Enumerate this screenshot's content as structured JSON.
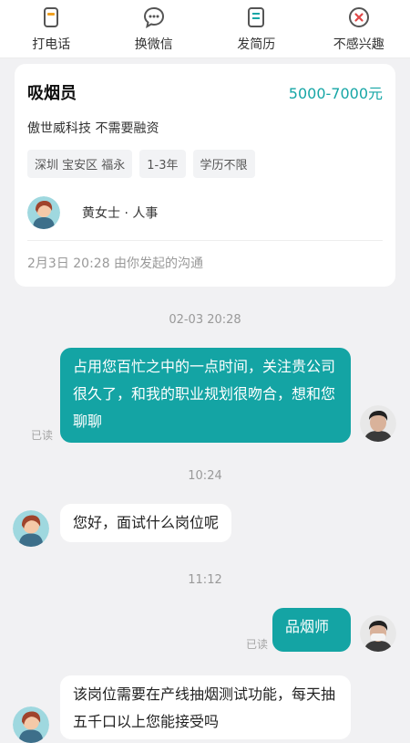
{
  "top_actions": [
    {
      "label": "打电话",
      "icon": "phone-icon"
    },
    {
      "label": "换微信",
      "icon": "wechat-icon"
    },
    {
      "label": "发简历",
      "icon": "resume-icon"
    },
    {
      "label": "不感兴趣",
      "icon": "not-interested-icon"
    }
  ],
  "job": {
    "title": "吸烟员",
    "salary": "5000-7000元",
    "company": "傲世威科技  不需要融资",
    "tags": [
      "深圳 宝安区 福永",
      "1-3年",
      "学历不限"
    ],
    "recruiter": "黄女士 · 人事",
    "chat_origin": "2月3日 20:28 由你发起的沟通"
  },
  "messages": {
    "time_1": "02-03 20:28",
    "msg_1": "占用您百忙之中的一点时间，关注贵公司很久了，和我的职业规划很吻合，想和您聊聊",
    "read_1": "已读",
    "time_2": "10:24",
    "msg_2": "您好，面试什么岗位呢",
    "time_3": "11:12",
    "msg_3": "品烟师",
    "read_3": "已读",
    "msg_4": "该岗位需要在产线抽烟测试功能，每天抽五千口以上您能接受吗"
  },
  "colors": {
    "accent": "#16a6a6",
    "bubble_mine": "#14a4a4",
    "background": "#f1f1f3"
  }
}
